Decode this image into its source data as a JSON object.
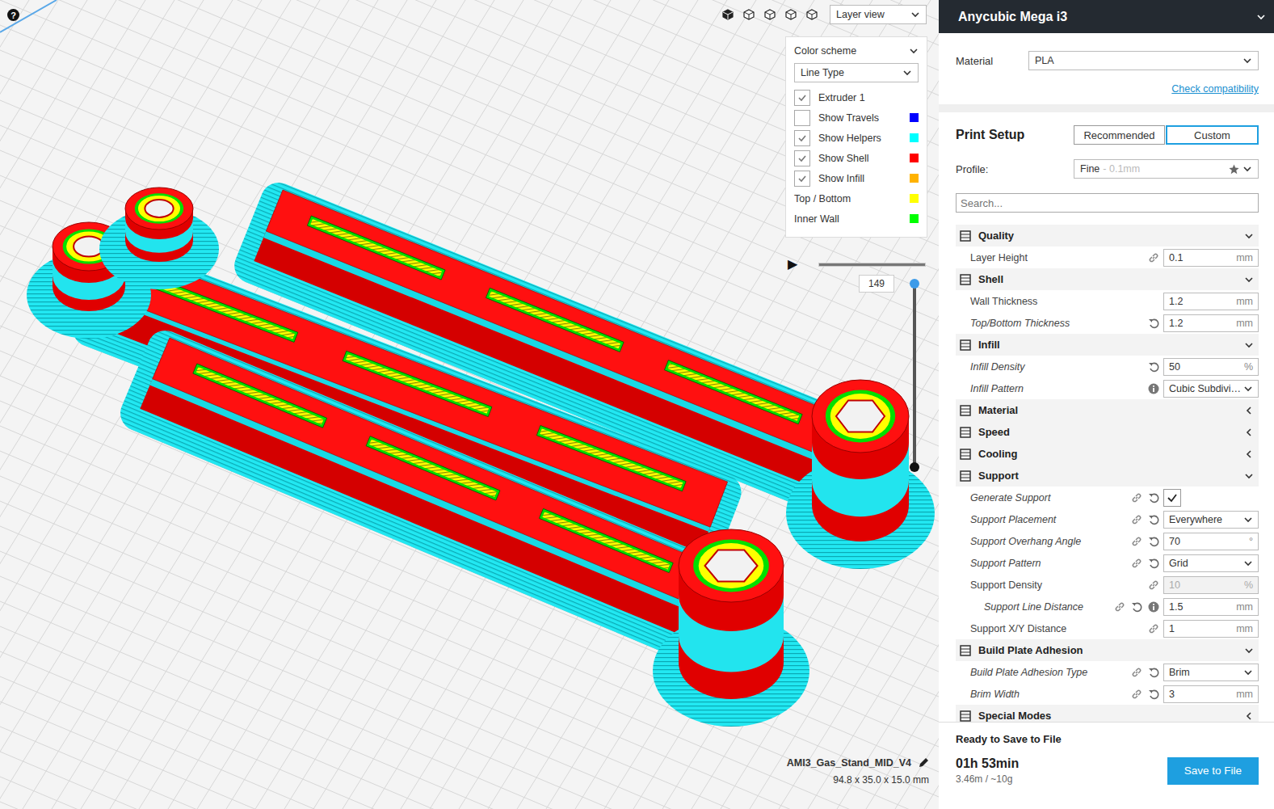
{
  "viewport": {
    "help_icon": "?",
    "view_mode": "Layer view"
  },
  "color_scheme": {
    "title": "Color scheme",
    "scheme": "Line Type",
    "items": [
      {
        "label": "Extruder 1",
        "kind": "check",
        "checked": true
      },
      {
        "label": "Show Travels",
        "kind": "check",
        "checked": false,
        "color": "#0000ff"
      },
      {
        "label": "Show Helpers",
        "kind": "check",
        "checked": true,
        "color": "#00ffff"
      },
      {
        "label": "Show Shell",
        "kind": "check",
        "checked": true,
        "color": "#ff0000"
      },
      {
        "label": "Show Infill",
        "kind": "check",
        "checked": true,
        "color": "#ffb200"
      },
      {
        "label": "Top / Bottom",
        "kind": "legend",
        "color": "#ffff00"
      },
      {
        "label": "Inner Wall",
        "kind": "legend",
        "color": "#00ff00"
      }
    ]
  },
  "layer_slider": {
    "play_icon": "▶",
    "layer": "149",
    "level": 1
  },
  "model": {
    "name": "AMI3_Gas_Stand_MID_V4",
    "dimensions": "94.8 x 35.0 x 15.0 mm"
  },
  "printer": {
    "name": "Anycubic Mega i3"
  },
  "material": {
    "label": "Material",
    "value": "PLA",
    "link": "Check compatibility"
  },
  "print_setup": {
    "title": "Print Setup",
    "tabs": [
      {
        "label": "Recommended",
        "selected": false
      },
      {
        "label": "Custom",
        "selected": true
      }
    ],
    "profile_label": "Profile:",
    "profile": "Fine",
    "profile_detail": "- 0.1mm"
  },
  "search": {
    "placeholder": "Search..."
  },
  "sections": [
    {
      "title": "Quality",
      "expanded": true,
      "settings": [
        {
          "label": "Layer Height",
          "kind": "number",
          "value": "0.1",
          "unit": "mm",
          "modified": false,
          "linked": true,
          "resettable": false,
          "info": false,
          "disabled": false,
          "child": false
        }
      ]
    },
    {
      "title": "Shell",
      "expanded": true,
      "settings": [
        {
          "label": "Wall Thickness",
          "kind": "number",
          "value": "1.2",
          "unit": "mm",
          "modified": false,
          "linked": false,
          "resettable": false,
          "info": false,
          "disabled": false,
          "child": false
        },
        {
          "label": "Top/Bottom Thickness",
          "kind": "number",
          "value": "1.2",
          "unit": "mm",
          "modified": true,
          "linked": false,
          "resettable": true,
          "info": false,
          "disabled": false,
          "child": false
        }
      ]
    },
    {
      "title": "Infill",
      "expanded": true,
      "settings": [
        {
          "label": "Infill Density",
          "kind": "number",
          "value": "50",
          "unit": "%",
          "modified": true,
          "linked": false,
          "resettable": true,
          "info": false,
          "disabled": false,
          "child": false
        },
        {
          "label": "Infill Pattern",
          "kind": "select",
          "value": "Cubic Subdivi…",
          "modified": true,
          "linked": false,
          "resettable": false,
          "info": true,
          "disabled": false,
          "child": false
        }
      ]
    },
    {
      "title": "Material",
      "expanded": false,
      "settings": []
    },
    {
      "title": "Speed",
      "expanded": false,
      "settings": []
    },
    {
      "title": "Cooling",
      "expanded": false,
      "settings": []
    },
    {
      "title": "Support",
      "expanded": true,
      "settings": [
        {
          "label": "Generate Support",
          "kind": "check",
          "checked": true,
          "modified": true,
          "linked": true,
          "resettable": true,
          "info": false,
          "disabled": false,
          "child": false
        },
        {
          "label": "Support Placement",
          "kind": "select",
          "value": "Everywhere",
          "modified": true,
          "linked": true,
          "resettable": true,
          "info": false,
          "disabled": false,
          "child": false
        },
        {
          "label": "Support Overhang Angle",
          "kind": "number",
          "value": "70",
          "unit": "°",
          "modified": true,
          "linked": true,
          "resettable": true,
          "info": false,
          "disabled": false,
          "child": false
        },
        {
          "label": "Support Pattern",
          "kind": "select",
          "value": "Grid",
          "modified": true,
          "linked": true,
          "resettable": true,
          "info": false,
          "disabled": false,
          "child": false
        },
        {
          "label": "Support Density",
          "kind": "number",
          "value": "10",
          "unit": "%",
          "modified": false,
          "linked": true,
          "resettable": false,
          "info": false,
          "disabled": true,
          "child": false
        },
        {
          "label": "Support Line Distance",
          "kind": "number",
          "value": "1.5",
          "unit": "mm",
          "modified": true,
          "linked": true,
          "resettable": true,
          "info": true,
          "disabled": false,
          "child": true
        },
        {
          "label": "Support X/Y Distance",
          "kind": "number",
          "value": "1",
          "unit": "mm",
          "modified": false,
          "linked": true,
          "resettable": false,
          "info": false,
          "disabled": false,
          "child": false
        }
      ]
    },
    {
      "title": "Build Plate Adhesion",
      "expanded": true,
      "settings": [
        {
          "label": "Build Plate Adhesion Type",
          "kind": "select",
          "value": "Brim",
          "modified": true,
          "linked": true,
          "resettable": true,
          "info": false,
          "disabled": false,
          "child": false
        },
        {
          "label": "Brim Width",
          "kind": "number",
          "value": "3",
          "unit": "mm",
          "modified": true,
          "linked": true,
          "resettable": true,
          "info": false,
          "disabled": false,
          "child": false
        }
      ]
    },
    {
      "title": "Special Modes",
      "expanded": false,
      "settings": []
    }
  ],
  "footer": {
    "status": "Ready to Save to File",
    "time": "01h 53min",
    "usage": "3.46m / ~10g",
    "button": "Save to File"
  }
}
